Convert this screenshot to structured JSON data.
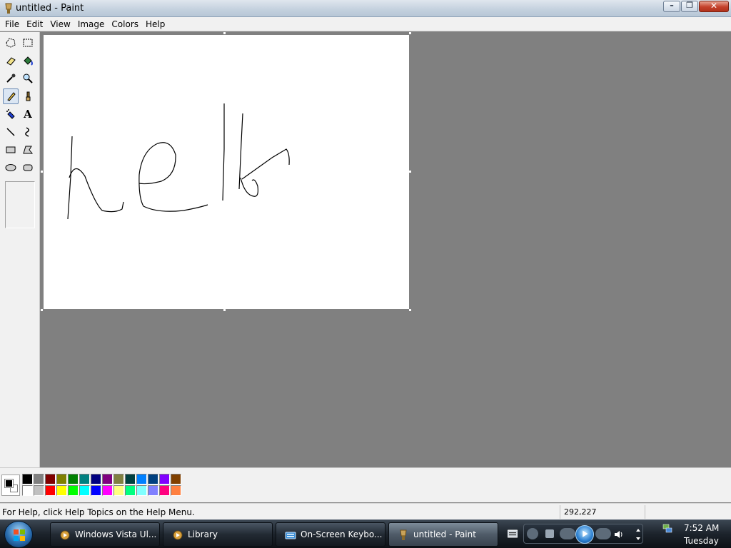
{
  "window": {
    "title": "untitled - Paint",
    "buttons": {
      "minimize": "–",
      "maximize": "❐",
      "close": "✕"
    }
  },
  "menu": [
    "File",
    "Edit",
    "View",
    "Image",
    "Colors",
    "Help"
  ],
  "tools": [
    {
      "name": "free-form-select-icon"
    },
    {
      "name": "select-icon"
    },
    {
      "name": "eraser-icon"
    },
    {
      "name": "fill-icon"
    },
    {
      "name": "pick-color-icon"
    },
    {
      "name": "magnifier-icon"
    },
    {
      "name": "pencil-icon",
      "active": true
    },
    {
      "name": "brush-icon"
    },
    {
      "name": "airbrush-icon"
    },
    {
      "name": "text-icon",
      "glyph": "A"
    },
    {
      "name": "line-icon"
    },
    {
      "name": "curve-icon"
    },
    {
      "name": "rectangle-icon"
    },
    {
      "name": "polygon-icon"
    },
    {
      "name": "ellipse-icon"
    },
    {
      "name": "rounded-rectangle-icon"
    }
  ],
  "palette": {
    "foreground": "#000000",
    "background": "#ffffff",
    "top_row": [
      "#000000",
      "#808080",
      "#800000",
      "#808000",
      "#008000",
      "#008080",
      "#000080",
      "#800080",
      "#808040",
      "#004040",
      "#0080ff",
      "#004080",
      "#8000ff",
      "#804000"
    ],
    "bottom_row": [
      "#ffffff",
      "#c0c0c0",
      "#ff0000",
      "#ffff00",
      "#00ff00",
      "#00ffff",
      "#0000ff",
      "#ff00ff",
      "#ffff80",
      "#00ff80",
      "#80ffff",
      "#8080ff",
      "#ff0080",
      "#ff8040"
    ]
  },
  "status": {
    "help_text": "For Help, click Help Topics on the Help Menu.",
    "coordinates": "292,227"
  },
  "taskbar": {
    "tasks": [
      {
        "label": "Windows Vista Ul...",
        "icon": "media-player-icon",
        "active": false
      },
      {
        "label": "Library",
        "icon": "media-player-icon",
        "active": false
      },
      {
        "label": "On-Screen Keybo...",
        "icon": "keyboard-icon",
        "active": false
      },
      {
        "label": "untitled - Paint",
        "icon": "paint-icon",
        "active": true
      }
    ],
    "clock_time": "7:52 AM",
    "clock_day": "Tuesday"
  }
}
